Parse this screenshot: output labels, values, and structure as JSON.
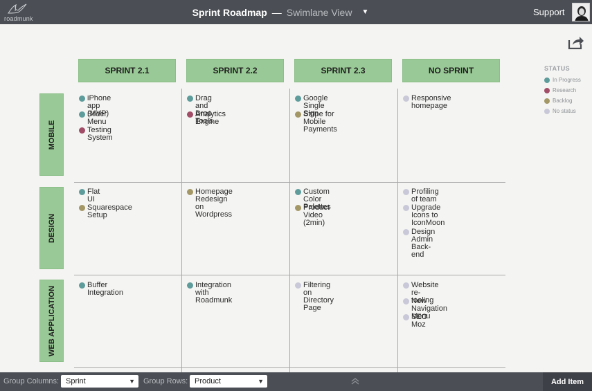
{
  "app": {
    "logo_text": "roadmunk",
    "title": "Sprint Roadmap",
    "separator": "—",
    "view_name": "Swimlane View",
    "support_label": "Support"
  },
  "columns": [
    {
      "label": "SPRINT 2.1"
    },
    {
      "label": "SPRINT 2.2"
    },
    {
      "label": "SPRINT 2.3"
    },
    {
      "label": "NO SPRINT"
    }
  ],
  "rows": [
    {
      "label": "MOBILE"
    },
    {
      "label": "DESIGN"
    },
    {
      "label": "WEB APPLICATION"
    }
  ],
  "status_colors": {
    "in_progress": "#5e9c9c",
    "research": "#a14d68",
    "backlog": "#a39766",
    "no_status": "#c8c8d8"
  },
  "cells": {
    "mobile": {
      "sprint_2_1": [
        {
          "label": "iPhone app (MVP)",
          "status": "in_progress"
        },
        {
          "label": "Slider Menu",
          "status": "in_progress"
        },
        {
          "label": "Testing System",
          "status": "research"
        }
      ],
      "sprint_2_2": [
        {
          "label": "Drag and Drop Tools",
          "status": "in_progress"
        },
        {
          "label": "Analytics Engine",
          "status": "research"
        }
      ],
      "sprint_2_3": [
        {
          "label": "Google Single Sign",
          "status": "in_progress"
        },
        {
          "label": "Stripe for Mobile",
          "label2": "Payments",
          "status": "backlog"
        }
      ],
      "no_sprint": [
        {
          "label": "Responsive homepage",
          "status": "no_status"
        }
      ]
    },
    "design": {
      "sprint_2_1": [
        {
          "label": "Flat UI",
          "status": "in_progress"
        },
        {
          "label": "Squarespace Setup",
          "status": "backlog"
        }
      ],
      "sprint_2_2": [
        {
          "label": "Homepage Redesign on",
          "label2": "Wordpress",
          "status": "backlog"
        }
      ],
      "sprint_2_3": [
        {
          "label": "Custom Color Palettes",
          "status": "in_progress"
        },
        {
          "label": "Product Video (2min)",
          "status": "backlog"
        }
      ],
      "no_sprint": [
        {
          "label": "Profiling of team",
          "status": "no_status"
        },
        {
          "label": "Upgrade Icons to",
          "label2": "IconMoon",
          "status": "no_status"
        },
        {
          "label": "Design Admin Back-end",
          "status": "no_status"
        }
      ]
    },
    "web_application": {
      "sprint_2_1": [
        {
          "label": "Buffer Integration",
          "status": "in_progress"
        }
      ],
      "sprint_2_2": [
        {
          "label": "Integration with",
          "label2": "Roadmunk",
          "status": "in_progress"
        }
      ],
      "sprint_2_3": [
        {
          "label": "Filtering on Directory Page",
          "status": "no_status"
        }
      ],
      "no_sprint": [
        {
          "label": "Website re-tooling",
          "status": "no_status"
        },
        {
          "label": "New Navigation Menu",
          "status": "no_status"
        },
        {
          "label": "SEO Moz",
          "status": "no_status"
        }
      ]
    }
  },
  "legend": {
    "title": "STATUS",
    "items": [
      {
        "label": "In Progress",
        "status": "in_progress"
      },
      {
        "label": "Research",
        "status": "research"
      },
      {
        "label": "Backlog",
        "status": "backlog"
      },
      {
        "label": "No status",
        "status": "no_status"
      }
    ]
  },
  "bottom_bar": {
    "group_columns_label": "Group Columns:",
    "group_columns_value": "Sprint",
    "group_rows_label": "Group Rows:",
    "group_rows_value": "Product",
    "add_item_label": "Add Item"
  },
  "icons": {
    "view_dropdown": "chevron-down-icon",
    "share": "share-icon",
    "collapse": "double-chevron-up-icon",
    "avatar": "user-avatar-icon"
  }
}
